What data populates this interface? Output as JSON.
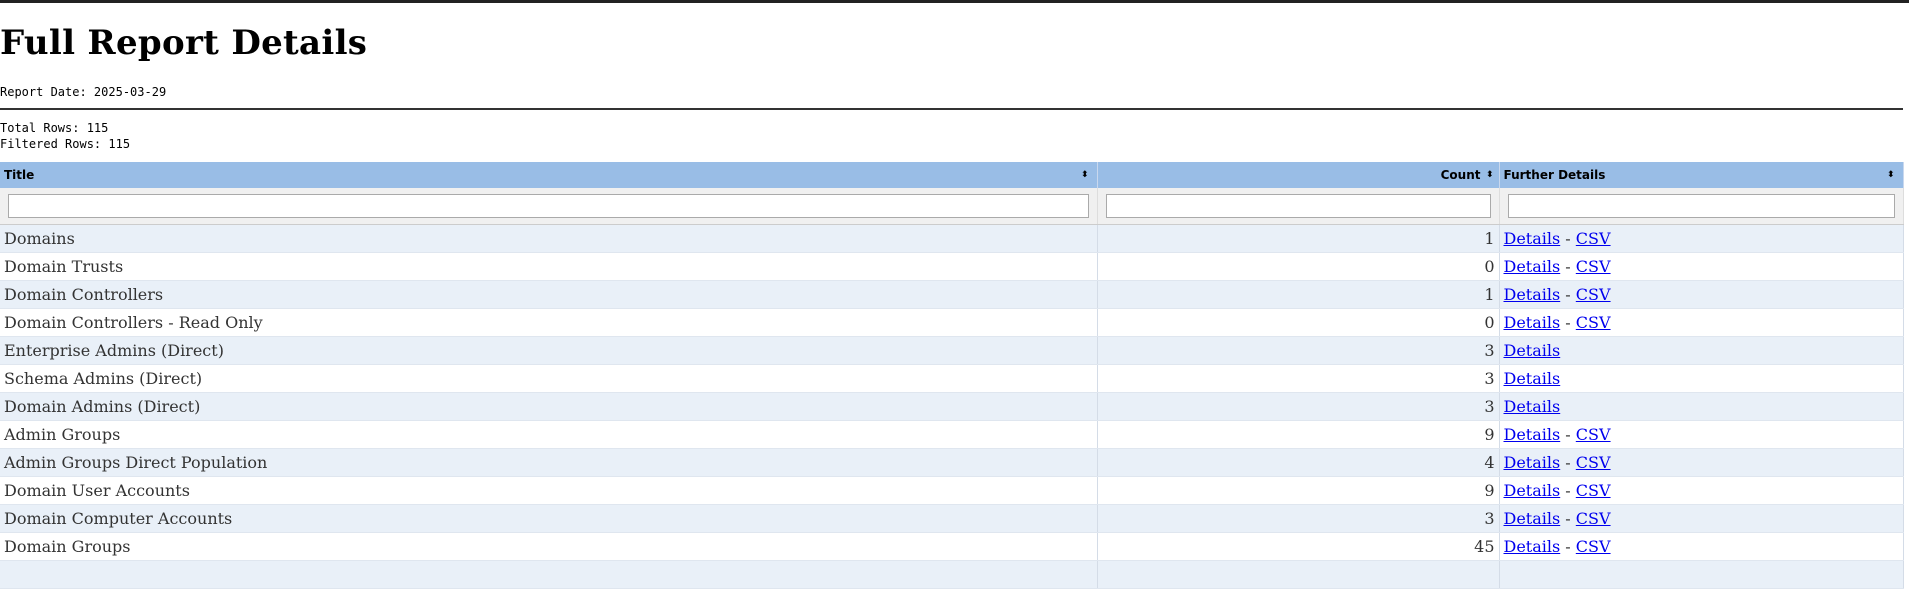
{
  "page": {
    "title": "Full Report Details",
    "report_date": "Report Date: 2025-03-29",
    "total_rows": "Total Rows: 115",
    "filtered_rows": "Filtered Rows: 115"
  },
  "table": {
    "headers": {
      "title": "Title",
      "count": "Count",
      "details": "Further Details"
    },
    "sort_icon": "⬍",
    "filters": {
      "title": "",
      "count": "",
      "details": ""
    },
    "link_labels": {
      "details": "Details",
      "csv": "CSV",
      "separator": " - "
    },
    "rows": [
      {
        "title": "Domains",
        "count": "1",
        "csv": true
      },
      {
        "title": "Domain Trusts",
        "count": "0",
        "csv": true
      },
      {
        "title": "Domain Controllers",
        "count": "1",
        "csv": true
      },
      {
        "title": "Domain Controllers - Read Only",
        "count": "0",
        "csv": true
      },
      {
        "title": "Enterprise Admins (Direct)",
        "count": "3",
        "csv": false
      },
      {
        "title": "Schema Admins (Direct)",
        "count": "3",
        "csv": false
      },
      {
        "title": "Domain Admins (Direct)",
        "count": "3",
        "csv": false
      },
      {
        "title": "Admin Groups",
        "count": "9",
        "csv": true
      },
      {
        "title": "Admin Groups Direct Population",
        "count": "4",
        "csv": true
      },
      {
        "title": "Domain User Accounts",
        "count": "9",
        "csv": true
      },
      {
        "title": "Domain Computer Accounts",
        "count": "3",
        "csv": true
      },
      {
        "title": "Domain Groups",
        "count": "45",
        "csv": true
      },
      {
        "title": "",
        "count": "",
        "csv": false
      }
    ]
  },
  "colors": {
    "header_bg": "#99bde6",
    "row_alt_bg": "#e9f0f8",
    "link": "#0000ee"
  }
}
